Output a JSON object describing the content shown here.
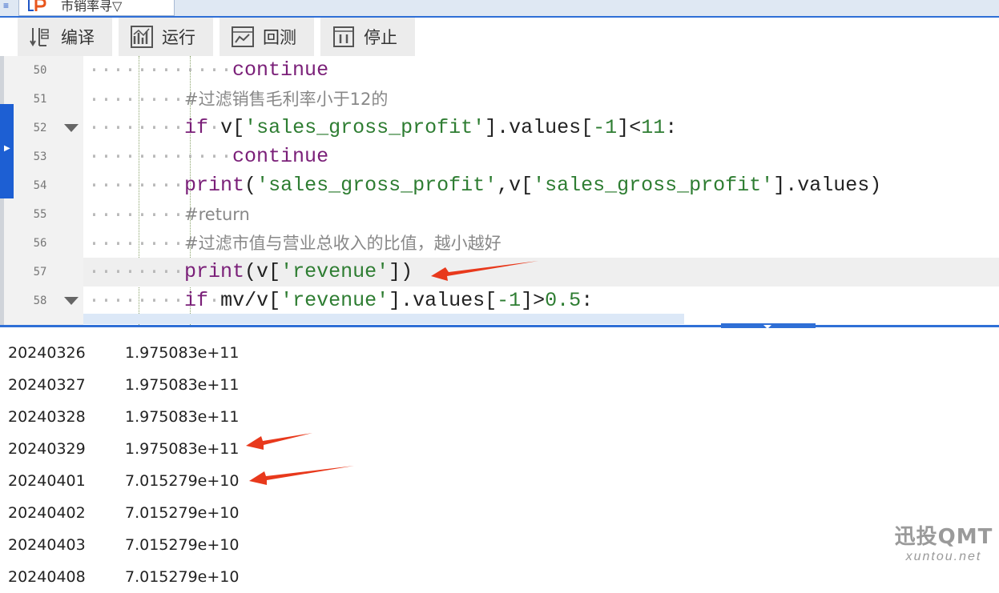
{
  "tab": {
    "file_name": "市销率寻▽",
    "arrow": "▼"
  },
  "toolbar": {
    "compile": "编译",
    "run": "运行",
    "backtest": "回测",
    "stop": "停止"
  },
  "code_lines": [
    {
      "no": "50",
      "ws": "········",
      "ws2": "····",
      "kw": "continue"
    },
    {
      "no": "51",
      "ws": "········",
      "comment": "#过滤销售毛利率小于12的"
    },
    {
      "no": "52",
      "ws": "········",
      "kw": "if",
      "ws_space": "·",
      "pre": "v[",
      "str": "'sales_gross_profit'",
      "mid": "].values[",
      "num1": "-1",
      "post": "]<",
      "num2": "11",
      "end": ":"
    },
    {
      "no": "53",
      "ws": "········",
      "ws2": "····",
      "kw": "continue"
    },
    {
      "no": "54",
      "ws": "········",
      "kw": "print",
      "p1": "(",
      "str1": "'sales_gross_profit'",
      "p2": ",v[",
      "str2": "'sales_gross_profit'",
      "p3": "].values)"
    },
    {
      "no": "55",
      "ws": "········",
      "comment": "#return"
    },
    {
      "no": "56",
      "ws": "········",
      "comment": "#过滤市值与营业总收入的比值，越小越好"
    },
    {
      "no": "57",
      "ws": "········",
      "kw": "print",
      "p1": "(v[",
      "str1": "'revenue'",
      "p2": "])"
    },
    {
      "no": "58",
      "ws": "········",
      "kw": "if",
      "ws_space": "·",
      "pre": "mv/v[",
      "str": "'revenue'",
      "mid": "].values[",
      "num1": "-1",
      "post": "]>",
      "num2": "0.5",
      "end": ":"
    }
  ],
  "output": [
    {
      "date": "20240326",
      "value": "1.975083e+11"
    },
    {
      "date": "20240327",
      "value": "1.975083e+11"
    },
    {
      "date": "20240328",
      "value": "1.975083e+11"
    },
    {
      "date": "20240329",
      "value": "1.975083e+11"
    },
    {
      "date": "20240401",
      "value": "7.015279e+10"
    },
    {
      "date": "20240402",
      "value": "7.015279e+10"
    },
    {
      "date": "20240403",
      "value": "7.015279e+10"
    },
    {
      "date": "20240408",
      "value": "7.015279e+10"
    }
  ],
  "watermark": {
    "main": "迅投QMT",
    "sub": "xuntou.net"
  },
  "colors": {
    "accent": "#2f6fd6",
    "keyword": "#7a1f78",
    "string": "#2e7d32",
    "comment": "#888888",
    "arrow": "#e8391c"
  }
}
